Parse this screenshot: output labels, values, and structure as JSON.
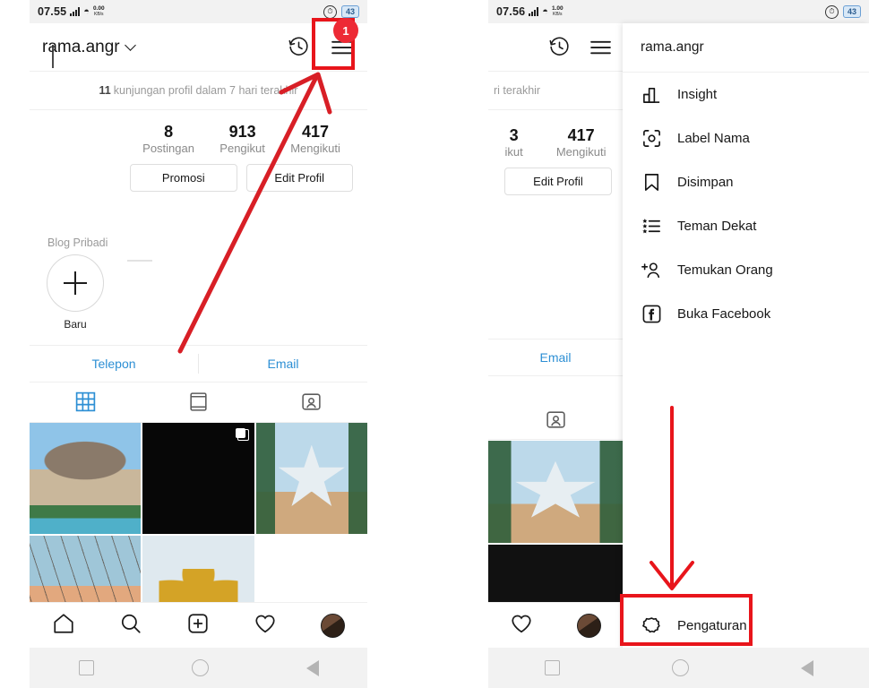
{
  "left_panel": {
    "status_bar": {
      "time": "07.55",
      "net_speed_value": "0.00",
      "net_speed_unit": "KB/s",
      "signal_icon": "signal-bars-icon",
      "wifi_icon": "wifi-icon"
    },
    "app_bar": {
      "username": "rama.angr",
      "chevron_icon": "chevron-down-icon",
      "history_icon": "clock-history-icon",
      "menu_icon": "hamburger-menu-icon",
      "menu_badge": "1"
    },
    "visits": {
      "count": "11",
      "text": "kunjungan profil dalam 7 hari terakhir"
    },
    "stats": [
      {
        "number": "8",
        "label": "Postingan"
      },
      {
        "number": "913",
        "label": "Pengikut"
      },
      {
        "number": "417",
        "label": "Mengikuti"
      }
    ],
    "buttons": {
      "promote": "Promosi",
      "edit_profile": "Edit Profil"
    },
    "highlights": {
      "title": "Blog Pribadi",
      "new_label": "Baru",
      "plus_icon": "plus-icon"
    },
    "contact": {
      "phone": "Telepon",
      "email": "Email"
    },
    "tabs": [
      {
        "name": "grid-tab",
        "icon": "grid-icon",
        "active": true
      },
      {
        "name": "reels-tab",
        "icon": "frame-icon",
        "active": false
      },
      {
        "name": "tagged-tab",
        "icon": "person-tagged-icon",
        "active": false
      }
    ],
    "grid_posts": [
      {
        "name": "post-canopy",
        "style": "ph-canopy",
        "multi": false
      },
      {
        "name": "post-black",
        "style": "ph-black",
        "multi": true
      },
      {
        "name": "post-star",
        "style": "ph-star",
        "multi": false
      },
      {
        "name": "post-sunset",
        "style": "ph-sunset",
        "multi": false
      },
      {
        "name": "post-wings",
        "style": "ph-wings",
        "multi": false
      },
      {
        "name": "post-empty",
        "style": "ph-empty",
        "multi": false
      }
    ],
    "bottom_nav": [
      {
        "name": "nav-home",
        "icon": "home-icon"
      },
      {
        "name": "nav-search",
        "icon": "search-icon"
      },
      {
        "name": "nav-create",
        "icon": "plus-square-icon"
      },
      {
        "name": "nav-activity",
        "icon": "heart-icon"
      },
      {
        "name": "nav-profile",
        "icon": "avatar-icon"
      }
    ],
    "system_nav": [
      {
        "name": "sysnav-recents",
        "icon": "square-icon"
      },
      {
        "name": "sysnav-home",
        "icon": "circle-icon"
      },
      {
        "name": "sysnav-back",
        "icon": "triangle-back-icon"
      }
    ]
  },
  "right_panel": {
    "status_bar": {
      "time": "07.56",
      "net_speed_value": "1.00",
      "net_speed_unit": "KB/s",
      "alarm_icon": "alarm-icon",
      "battery_level": "43"
    },
    "behind": {
      "history_icon": "clock-history-icon",
      "menu_icon": "hamburger-menu-icon",
      "visits_fragment": "ri terakhir",
      "stats": [
        {
          "number": "3",
          "label": "ikut"
        },
        {
          "number": "417",
          "label": "Mengikuti"
        }
      ],
      "edit_profile": "Edit Profil",
      "email": "Email",
      "tagged_icon": "person-tagged-icon"
    },
    "drawer": {
      "header_username": "rama.angr",
      "items": [
        {
          "label": "Insight",
          "icon": "bar-chart-icon",
          "name": "menu-item-insight"
        },
        {
          "label": "Label Nama",
          "icon": "nametag-icon",
          "name": "menu-item-label-nama"
        },
        {
          "label": "Disimpan",
          "icon": "bookmark-icon",
          "name": "menu-item-disimpan"
        },
        {
          "label": "Teman Dekat",
          "icon": "close-friends-list-icon",
          "name": "menu-item-teman-dekat"
        },
        {
          "label": "Temukan Orang",
          "icon": "discover-people-icon",
          "name": "menu-item-temukan-orang"
        },
        {
          "label": "Buka Facebook",
          "icon": "facebook-icon",
          "name": "menu-item-buka-facebook"
        }
      ],
      "settings": {
        "label": "Pengaturan",
        "icon": "gear-icon"
      }
    },
    "bottom_nav": [
      {
        "name": "nav-activity",
        "icon": "heart-icon"
      },
      {
        "name": "nav-profile",
        "icon": "avatar-icon"
      }
    ],
    "system_nav": [
      {
        "name": "sysnav-recents",
        "icon": "square-icon"
      },
      {
        "name": "sysnav-home",
        "icon": "circle-icon"
      },
      {
        "name": "sysnav-back",
        "icon": "triangle-back-icon"
      }
    ]
  },
  "annotations": {
    "accent_color": "#e8151b",
    "badge_color": "#ed2a35",
    "left_arrow": "arrow-pointing-to-hamburger-menu",
    "right_arrow": "arrow-pointing-to-pengaturan",
    "left_highlight": "red-box-around-hamburger-menu",
    "right_highlight": "red-box-around-pengaturan"
  }
}
